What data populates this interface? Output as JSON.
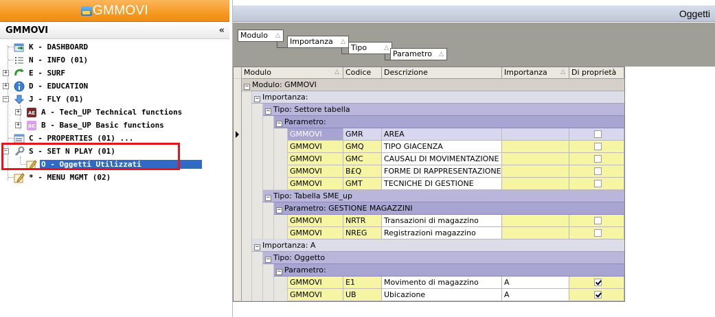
{
  "app": {
    "title": "GMMOVI"
  },
  "tree_panel": {
    "title": "GMMOVI",
    "collapse_glyph": "«",
    "items": [
      {
        "label": "K - DASHBOARD",
        "icon": "dashboard-icon"
      },
      {
        "label": "N - INFO (01)",
        "icon": "list-icon"
      },
      {
        "label": "E - SURF",
        "icon": "refresh-icon"
      },
      {
        "label": "D - EDUCATION",
        "icon": "info-icon"
      },
      {
        "label": "J - FLY (01)",
        "icon": "download-arrow-icon"
      },
      {
        "label": "A - Tech_UP Technical functions",
        "icon": "tech-up-icon"
      },
      {
        "label": "B - Base_UP Basic functions",
        "icon": "base-up-icon"
      },
      {
        "label": "C - PROPERTIES (01) ...",
        "icon": "properties-icon"
      },
      {
        "label": "S - SET N PLAY (01)",
        "icon": "wrench-icon"
      },
      {
        "label": "O - Oggetti Utilizzati",
        "icon": "edit-icon",
        "selected": true
      },
      {
        "label": "* - MENU MGMT (02)",
        "icon": "edit-icon"
      }
    ]
  },
  "main_panel": {
    "title": "Oggetti",
    "group_by": [
      "Modulo",
      "Importanza",
      "Tipo",
      "Parametro"
    ],
    "columns": [
      "Modulo",
      "Codice",
      "Descrizione",
      "Importanza",
      "Di proprietà"
    ],
    "groups": {
      "modulo": "Modulo: GMMOVI",
      "imp_empty": "Importanza:",
      "tipo_settore": "Tipo: Settore tabella",
      "param_empty_1": "Parametro:",
      "tipo_sme": "Tipo: Tabella SME_up",
      "param_gestione": "Parametro: GESTIONE MAGAZZINI",
      "imp_a": "Importanza: A",
      "tipo_oggetto": "Tipo: Oggetto",
      "param_empty_2": "Parametro:"
    },
    "rows": [
      {
        "modulo": "GMMOVI",
        "codice": "GMR",
        "descrizione": "AREA",
        "importanza": "",
        "di_proprieta": false
      },
      {
        "modulo": "GMMOVI",
        "codice": "GMQ",
        "descrizione": "TIPO GIACENZA",
        "importanza": "",
        "di_proprieta": false
      },
      {
        "modulo": "GMMOVI",
        "codice": "GMC",
        "descrizione": "CAUSALI DI MOVIMENTAZIONE",
        "importanza": "",
        "di_proprieta": false
      },
      {
        "modulo": "GMMOVI",
        "codice": "B£Q",
        "descrizione": "FORME DI RAPPRESENTAZIONE",
        "importanza": "",
        "di_proprieta": false
      },
      {
        "modulo": "GMMOVI",
        "codice": "GMT",
        "descrizione": "TECNICHE DI GESTIONE",
        "importanza": "",
        "di_proprieta": false
      },
      {
        "modulo": "GMMOVI",
        "codice": "NRTR",
        "descrizione": "Transazioni di magazzino",
        "importanza": "",
        "di_proprieta": false
      },
      {
        "modulo": "GMMOVI",
        "codice": "NREG",
        "descrizione": "Registrazioni magazzino",
        "importanza": "",
        "di_proprieta": false
      },
      {
        "modulo": "GMMOVI",
        "codice": "E1",
        "descrizione": "Movimento di magazzino",
        "importanza": "A",
        "di_proprieta": true
      },
      {
        "modulo": "GMMOVI",
        "codice": "UB",
        "descrizione": "Ubicazione",
        "importanza": "A",
        "di_proprieta": true
      }
    ]
  },
  "colors": {
    "header_orange": "#f59a23",
    "selection_blue": "#316ac5",
    "highlight_red": "#e8141c",
    "row_yellow": "#f5f5a3"
  }
}
